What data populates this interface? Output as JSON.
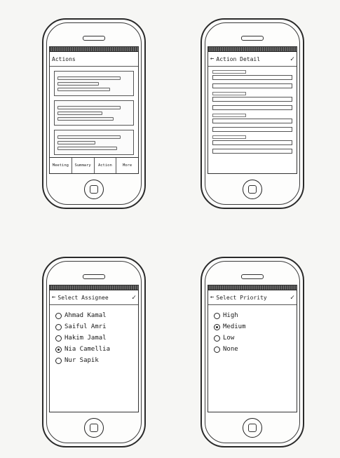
{
  "screens": {
    "actions": {
      "title": "Actions",
      "tabs": [
        "Meeting",
        "Summary",
        "Action",
        "More"
      ]
    },
    "action_detail": {
      "title": "Action Detail"
    },
    "select_assignee": {
      "title": "Select Assignee",
      "options": [
        "Ahmad Kamal",
        "Saiful Amri",
        "Hakim Jamal",
        "Nia Camellia",
        "Nur Sapik"
      ],
      "selected_index": 3
    },
    "select_priority": {
      "title": "Select Priority",
      "options": [
        "High",
        "Medium",
        "Low",
        "None"
      ],
      "selected_index": 1
    }
  },
  "icons": {
    "back": "←",
    "check": "✓"
  }
}
